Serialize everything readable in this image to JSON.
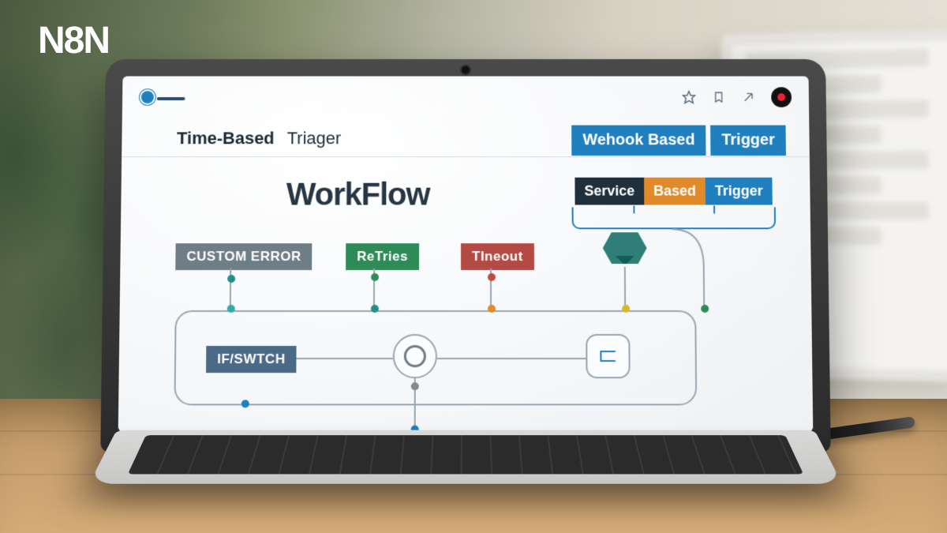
{
  "brand": "N8N",
  "topbar": {
    "icons": [
      "star",
      "bookmark",
      "share"
    ],
    "record": true
  },
  "tabs": {
    "left_main": "Time-Based",
    "left_sub": "Triager",
    "right_main": "Wehook Based",
    "right_sub": "Trigger"
  },
  "canvas": {
    "title": "WorkFlow",
    "service_pills": [
      "Service",
      "Based",
      "Trigger"
    ],
    "chips": {
      "custom_error": "CUSTOM ERROR",
      "retries": "ReTries",
      "timeout": "TIneout",
      "ifswitch": "IF/SWTCH"
    }
  }
}
